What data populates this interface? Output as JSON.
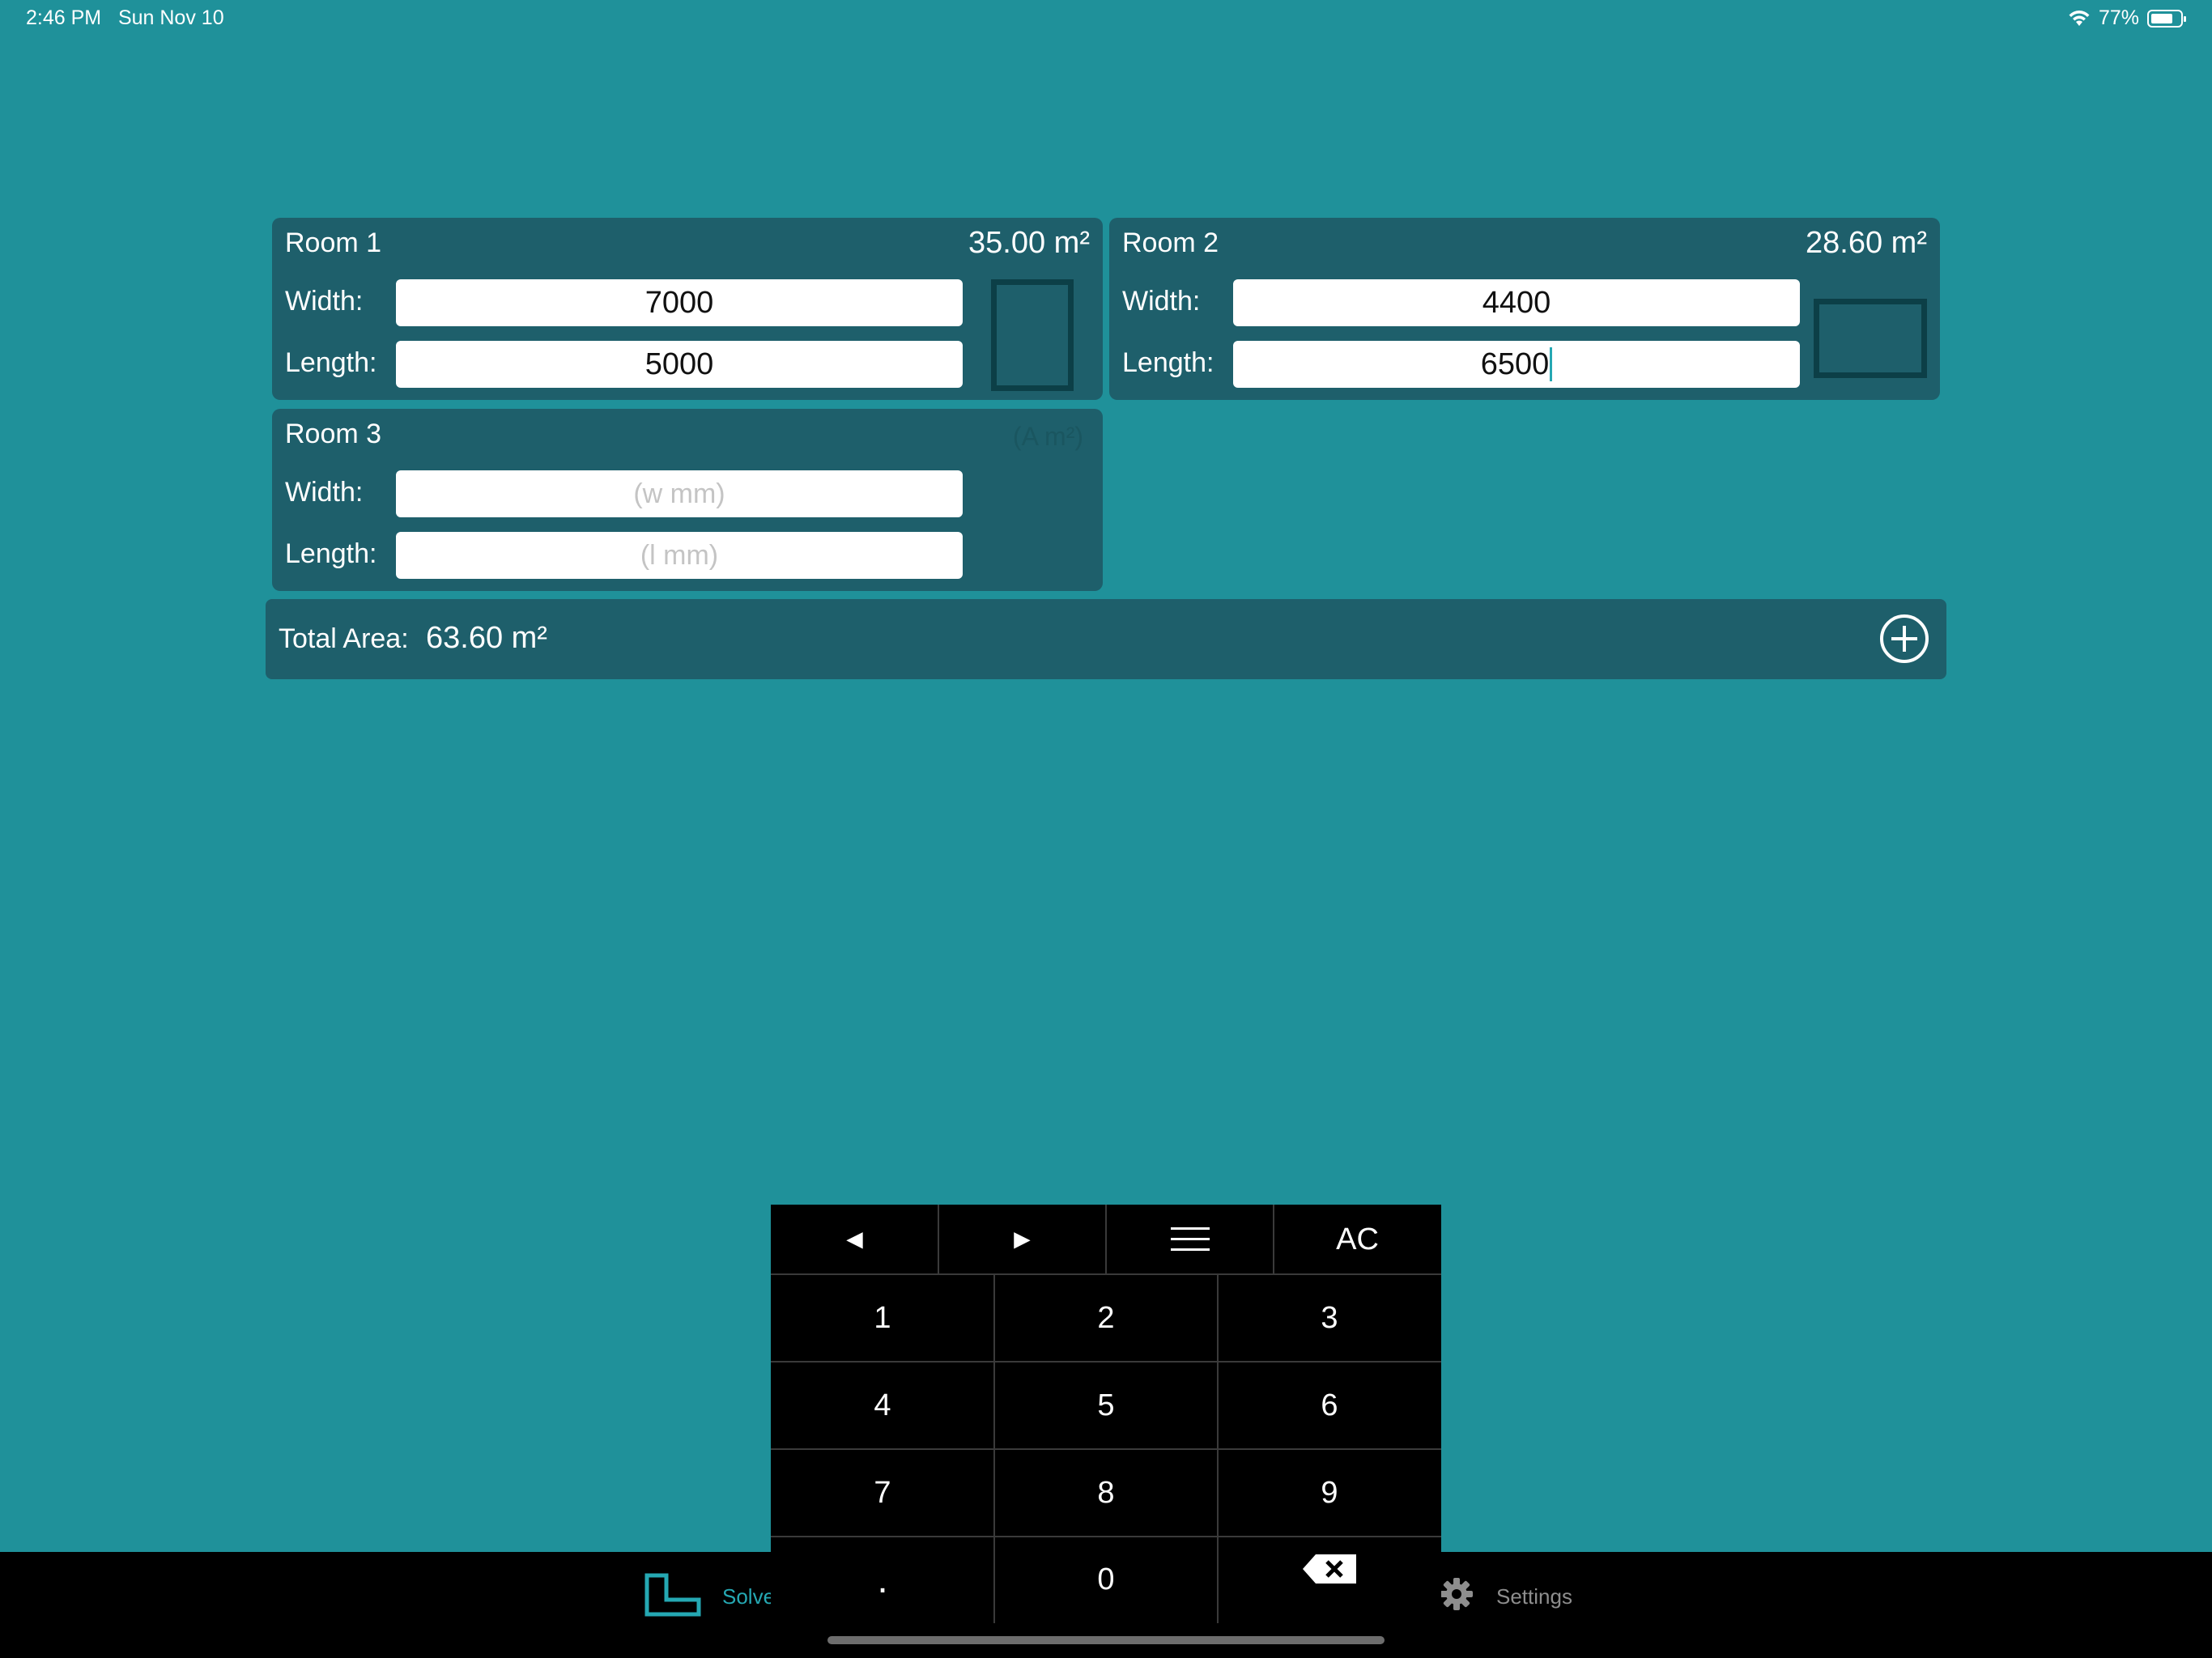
{
  "status_bar": {
    "time": "2:46 PM",
    "date": "Sun Nov 10",
    "battery": "77%",
    "battery_level": 0.77
  },
  "rooms": [
    {
      "title": "Room 1",
      "area": "35.00 m²",
      "width_label": "Width:",
      "length_label": "Length:",
      "width_value": "7000",
      "length_value": "5000"
    },
    {
      "title": "Room 2",
      "area": "28.60 m²",
      "width_label": "Width:",
      "length_label": "Length:",
      "width_value": "4400",
      "length_value": "6500"
    },
    {
      "title": "Room 3",
      "area_placeholder": "(A m²)",
      "width_label": "Width:",
      "length_label": "Length:",
      "width_placeholder": "(w mm)",
      "length_placeholder": "(l mm)"
    }
  ],
  "total": {
    "label": "Total Area:",
    "value": "63.60 m²"
  },
  "keypad": {
    "top_row": [
      "◄",
      "►",
      "☰",
      "AC"
    ],
    "digits": [
      "1",
      "2",
      "3",
      "4",
      "5",
      "6",
      "7",
      "8",
      "9",
      "."
    ],
    "zero": "0",
    "backspace_icon": "backspace-icon"
  },
  "tabbar": {
    "solve_label": "Solve",
    "settings_label": "Settings"
  },
  "colors": {
    "background": "#1f919a",
    "card": "#1e5f6b",
    "accent": "#25a8b3"
  }
}
